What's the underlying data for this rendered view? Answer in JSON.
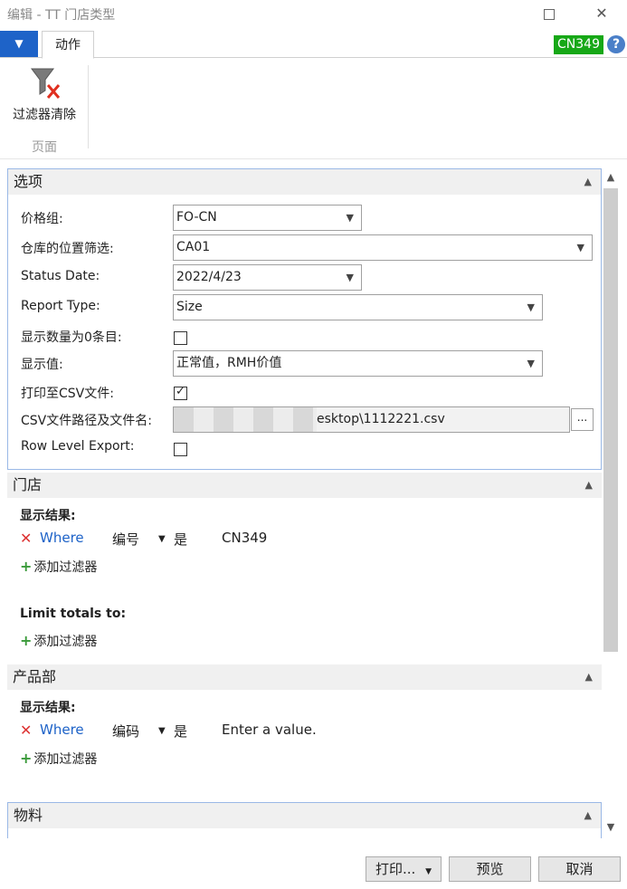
{
  "window": {
    "title": "编辑 - TT 门店类型"
  },
  "ribbon": {
    "tab_label": "动作",
    "company_badge": "CN349",
    "help": "?",
    "clear_filter_label": "过滤器清除",
    "group_label": "页面"
  },
  "options": {
    "header": "选项",
    "fields": {
      "price_group": {
        "label": "价格组:",
        "value": "FO-CN"
      },
      "location_filter": {
        "label": "仓库的位置筛选:",
        "value": "CA01"
      },
      "status_date": {
        "label": "Status Date:",
        "value": "2022/4/23"
      },
      "report_type": {
        "label": "Report Type:",
        "value": "Size"
      },
      "show_zero": {
        "label": "显示数量为0条目:",
        "checked": false
      },
      "display_value": {
        "label": "显示值:",
        "value": "正常值，RMH价值"
      },
      "print_csv": {
        "label": "打印至CSV文件:",
        "checked": true
      },
      "csv_path": {
        "label": "CSV文件路径及文件名:",
        "value": "esktop\\1112221.csv"
      },
      "row_level_export": {
        "label": "Row Level Export:",
        "checked": false
      }
    }
  },
  "store": {
    "header": "门店",
    "show_results_label": "显示结果:",
    "filter": {
      "where": "Where",
      "field": "编号",
      "is": "是",
      "value": "CN349"
    },
    "add_filter_label": "添加过滤器",
    "limit_totals_label": "Limit totals to:",
    "limit_add_filter_label": "添加过滤器"
  },
  "product_group": {
    "header": "产品部",
    "show_results_label": "显示结果:",
    "filter": {
      "where": "Where",
      "field": "编码",
      "is": "是",
      "value": "Enter a value."
    },
    "add_filter_label": "添加过滤器"
  },
  "item": {
    "header": "物料"
  },
  "buttons": {
    "print": "打印...",
    "preview": "预览",
    "cancel": "取消"
  }
}
